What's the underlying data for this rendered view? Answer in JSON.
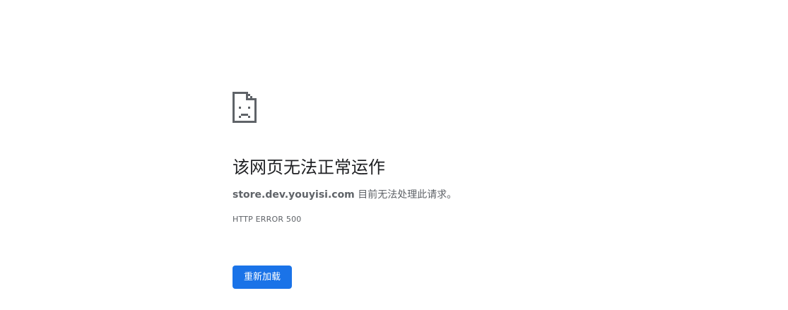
{
  "error_page": {
    "icon": "sad-page-icon",
    "title": "该网页无法正常运作",
    "host": "store.dev.youyisi.com",
    "message": " 目前无法处理此请求。",
    "error_code": "HTTP ERROR 500",
    "reload_label": "重新加载",
    "accent_color": "#1a73e8"
  }
}
